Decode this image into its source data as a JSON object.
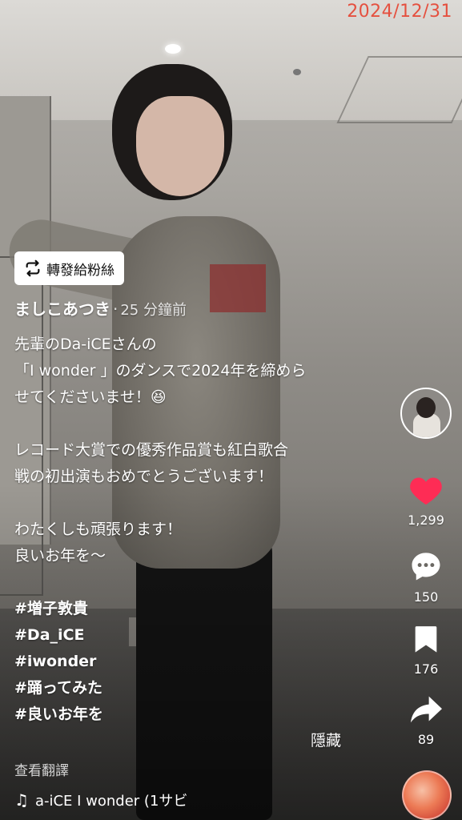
{
  "overlay": {
    "date": "2024/12/31"
  },
  "repost": {
    "label": "轉發給粉絲"
  },
  "author": {
    "name": "ましこあつき",
    "separator": "·",
    "time": "25 分鐘前"
  },
  "caption": {
    "lines": [
      "先輩のDa-iCEさんの",
      "「I wonder 」のダンスで2024年を締めら",
      "せてくださいませ！😆",
      "",
      "レコード大賞での優秀作品賞も紅白歌合",
      "戦の初出演もおめでとうございます！",
      "",
      "わたくしも頑張ります！",
      "良いお年を〜",
      ""
    ],
    "hashtags": [
      "#増子敦貴",
      "#Da_iCE",
      "#iwonder",
      "#踊ってみた",
      "#良いお年を"
    ]
  },
  "actions": {
    "hide": "隱藏",
    "translate": "查看翻譯",
    "likes": "1,299",
    "comments": "150",
    "saves": "176",
    "shares": "89"
  },
  "music": {
    "icon": "music-note-icon",
    "text": "a-iCE    I wonder (1サビ"
  },
  "colors": {
    "like": "#fe2c55",
    "date": "#e5503f"
  }
}
